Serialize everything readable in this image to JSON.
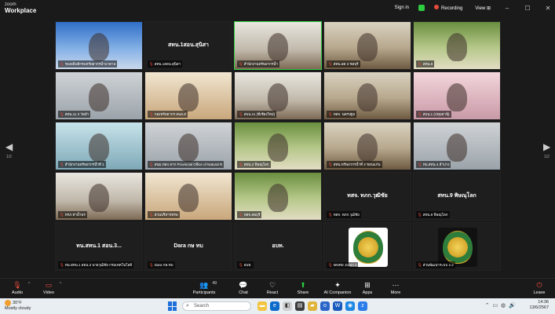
{
  "app": {
    "brand_line1": "zoom",
    "brand_line2": "Workplace"
  },
  "titlebar": {
    "sign_in": "Sign in",
    "recording": "Recording",
    "view": "View",
    "view_caret": "⊞",
    "minimize": "–",
    "maximize": "☐",
    "close": "✕"
  },
  "nav": {
    "prev_page": "1/2",
    "next_page": "1/2",
    "prev_icon": "◀",
    "next_icon": "▶"
  },
  "tiles": [
    {
      "name": "รองอธิบดีกรมทรัพยากรน้ำบาดาล",
      "bg": "bg-blue",
      "overlay": ""
    },
    {
      "name": "สทน.1สอน.สุนิสา",
      "bg": "name-only",
      "overlay": "สทน.1สอน.สุนิสา"
    },
    {
      "name": "สำนักงานทรัพยากรน้ำ",
      "bg": "bg-room",
      "overlay": ""
    },
    {
      "name": "สทน.ลด 3 ชลบุรี",
      "bg": "bg-office",
      "overlay": ""
    },
    {
      "name": "สทน.9",
      "bg": "bg-green",
      "overlay": ""
    },
    {
      "name": "สทน.11 3 วัดลำ",
      "bg": "bg-gray",
      "overlay": ""
    },
    {
      "name": "กองทรัพยากร สนล.ส",
      "bg": "bg-warm",
      "overlay": ""
    },
    {
      "name": "สบน.11 (ที่เชียงใหม่)",
      "bg": "bg-room",
      "overlay": ""
    },
    {
      "name": "ทสจ. นครปฐม",
      "bg": "bg-office",
      "overlay": ""
    },
    {
      "name": "สบน.1 (ปทุมธานี)",
      "bg": "bg-pink",
      "overlay": ""
    },
    {
      "name": "สำนักงานทรัพยากรน้ำที่ 1",
      "bg": "bg-teal",
      "overlay": ""
    },
    {
      "name": "สนม.ทส4 ลาก Provincial Office of Natural R",
      "bg": "bg-gray",
      "overlay": ""
    },
    {
      "name": "สทน.2 พิษณุโลก",
      "bg": "bg-green",
      "overlay": ""
    },
    {
      "name": "สทน.ทรัพยากรน้ำที่ 4 ขอนแก่น",
      "bg": "bg-office",
      "overlay": ""
    },
    {
      "name": "ทบ.สทน.4 ลำปาง",
      "bg": "bg-gray",
      "overlay": ""
    },
    {
      "name": "ทรภ.ท่าน้ำพร",
      "bg": "bg-room",
      "overlay": ""
    },
    {
      "name": "ส่วนบริหารทรพ",
      "bg": "bg-warm",
      "overlay": ""
    },
    {
      "name": "ทสจ.ลพบุรี",
      "bg": "bg-green",
      "overlay": ""
    },
    {
      "name": "ทสจ. ทภก.วุฒิชัย",
      "bg": "name-only",
      "overlay": "ทสจ. ทภก.วุฒิชัย"
    },
    {
      "name": "สทน.9 พิษณุโลก",
      "bg": "name-only",
      "overlay": "สทน.9 พิษณุโลก"
    },
    {
      "name": "ทน.สทน.1 สอน.3 นายวุฒิชัย กรมเทคโนโลยี",
      "bg": "name-only",
      "overlay": "ทน.สทน.1 สอน.3..."
    },
    {
      "name": "Dara กษ ทบ",
      "bg": "name-only",
      "overlay": "Dara กษ ทบ"
    },
    {
      "name": "อบท.",
      "bg": "name-only",
      "overlay": "อบท."
    },
    {
      "name": "MNRE Zoom 2",
      "bg": "emblem",
      "overlay": ""
    },
    {
      "name": "ส่วนพัฒนาระบบ 2.2",
      "bg": "emblem-dark",
      "overlay": ""
    }
  ],
  "toolbar": {
    "audio": "Audio",
    "video": "Video",
    "participants": "Participants",
    "participants_count": "49",
    "chat": "Chat",
    "react": "React",
    "share": "Share",
    "ai_companion": "AI Companion",
    "apps": "Apps",
    "more": "More",
    "leave": "Leave"
  },
  "taskbar": {
    "temperature": "30°F",
    "weather": "Mostly cloudy",
    "search_placeholder": "Search",
    "time": "14:36",
    "date": "13/6/2567"
  },
  "colors": {
    "accent_green": "#2ecc40",
    "leave_red": "#e74c3c",
    "brand_blue": "#1e6fd9"
  }
}
